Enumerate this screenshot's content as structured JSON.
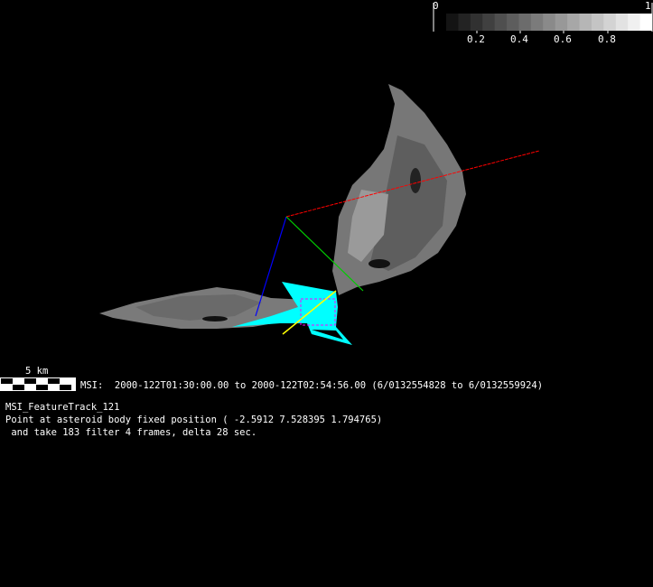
{
  "colorbar": {
    "min_label": "0",
    "max_label": "1",
    "ticks": [
      "0.2",
      "0.4",
      "0.6",
      "0.8"
    ],
    "steps": 17
  },
  "scale_bar": {
    "label": "5 km"
  },
  "msi_line": "MSI:  2000-122T01:30:00.00 to 2000-122T02:54:56.00 (6/0132554828 to 6/0132559924)",
  "info": {
    "name": "MSI_FeatureTrack_121",
    "line1": "Point at asteroid body fixed position ( -2.5912 7.528395 1.794765)",
    "line2": " and take 183 filter 4 frames, delta 28 sec."
  },
  "colors": {
    "x_axis": "#ff0000",
    "y_axis": "#00cc00",
    "z_axis": "#0000ff",
    "footprint": "#00ffff",
    "boresight": "#ffff00",
    "fov_box": "#ff00ff",
    "asteroid": "#8a8a8a"
  }
}
